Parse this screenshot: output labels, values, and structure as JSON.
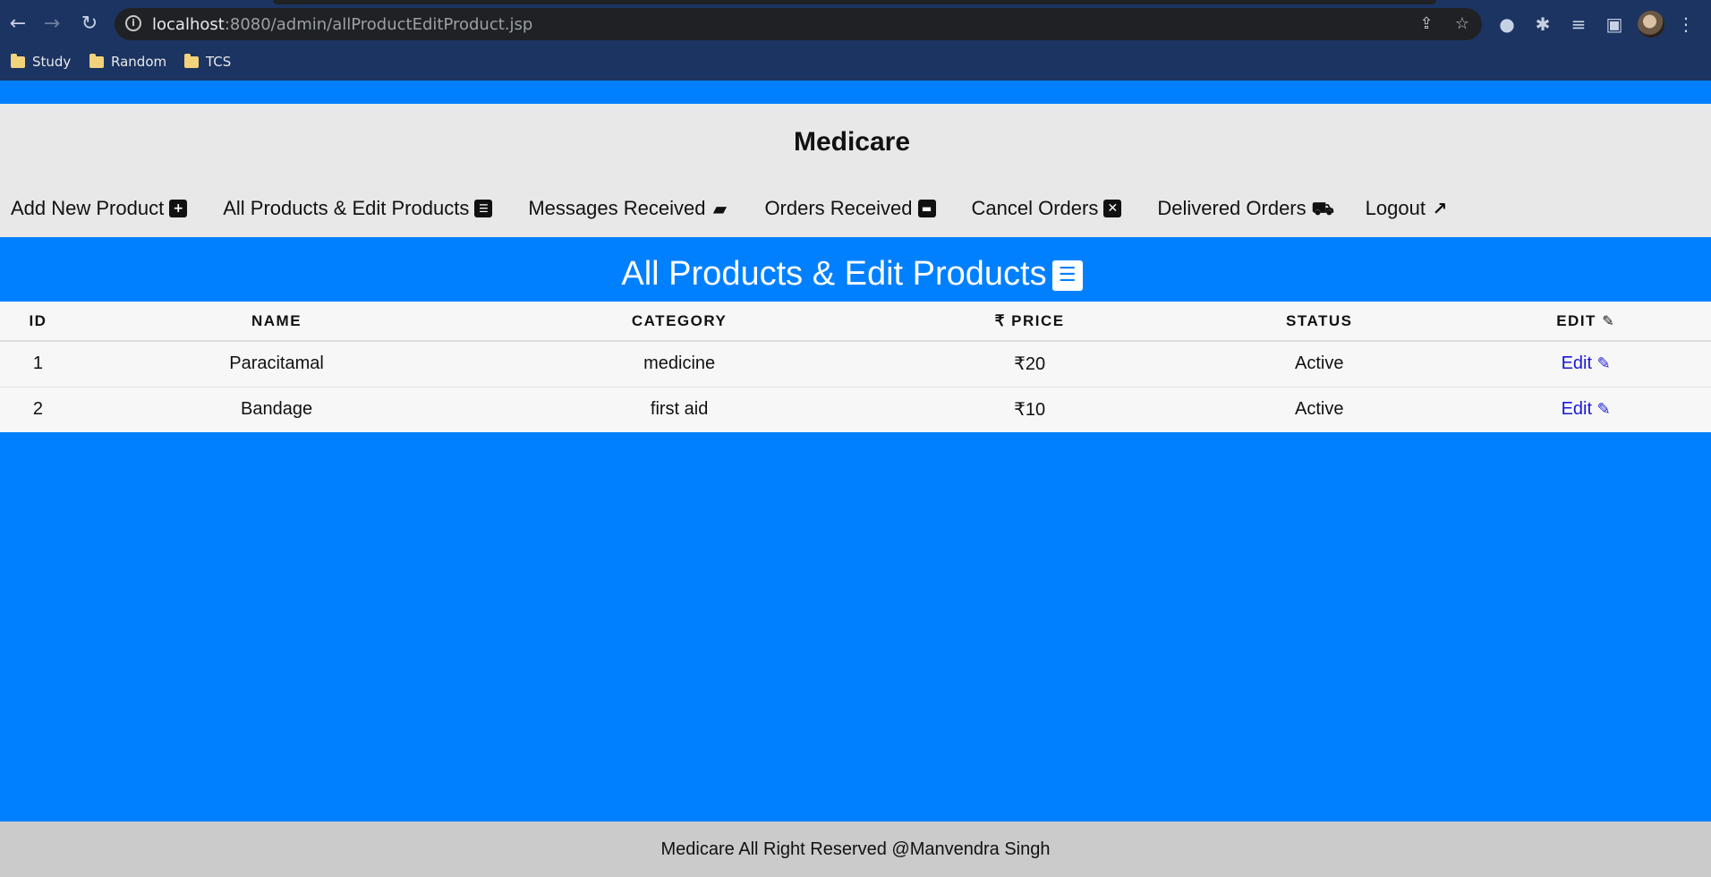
{
  "browser": {
    "url_host": "localhost",
    "url_rest": ":8080/admin/allProductEditProduct.jsp",
    "bookmarks": [
      "Study",
      "Random",
      "TCS"
    ]
  },
  "header": {
    "brand": "Medicare",
    "nav": [
      {
        "label": "Add New Product",
        "icon": "plus-square-icon"
      },
      {
        "label": "All Products & Edit Products",
        "icon": "list-icon"
      },
      {
        "label": "Messages Received",
        "icon": "comment-icon"
      },
      {
        "label": "Orders Received",
        "icon": "archive-icon"
      },
      {
        "label": "Cancel Orders",
        "icon": "close-square-icon"
      },
      {
        "label": "Delivered Orders",
        "icon": "dolly-icon"
      },
      {
        "label": "Logout",
        "icon": "share-icon"
      }
    ]
  },
  "main": {
    "title": "All Products & Edit Products",
    "table": {
      "headers": [
        "ID",
        "NAME",
        "CATEGORY",
        "₹ PRICE",
        "STATUS",
        "EDIT"
      ],
      "rows": [
        {
          "id": "1",
          "name": "Paracitamal",
          "category": "medicine",
          "price": "₹20",
          "status": "Active",
          "edit": "Edit"
        },
        {
          "id": "2",
          "name": "Bandage",
          "category": "first aid",
          "price": "₹10",
          "status": "Active",
          "edit": "Edit"
        }
      ]
    }
  },
  "footer": {
    "text": "Medicare All Right Reserved @Manvendra Singh"
  },
  "colors": {
    "accent": "#0080ff",
    "header_bg": "#e8e8e8",
    "footer_bg": "#cbcbcb",
    "link": "#1a1ad6"
  }
}
